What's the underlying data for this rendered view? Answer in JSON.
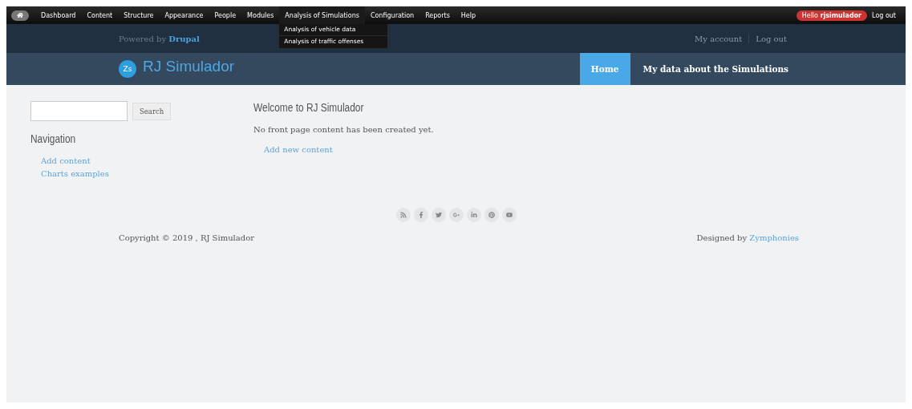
{
  "admin_toolbar": {
    "items": [
      {
        "label": "Dashboard",
        "expanded": false
      },
      {
        "label": "Content",
        "expanded": false
      },
      {
        "label": "Structure",
        "expanded": false
      },
      {
        "label": "Appearance",
        "expanded": false
      },
      {
        "label": "People",
        "expanded": false
      },
      {
        "label": "Modules",
        "expanded": false
      },
      {
        "label": "Analysis of Simulations",
        "expanded": true,
        "children": [
          "Analysis of vehicle data",
          "Analysis of traffic offenses"
        ]
      },
      {
        "label": "Configuration",
        "expanded": false
      },
      {
        "label": "Reports",
        "expanded": false
      },
      {
        "label": "Help",
        "expanded": false
      }
    ],
    "greeting": "Hello",
    "username": "rjsimulador",
    "logout": "Log out"
  },
  "header": {
    "powered_by": "Powered by",
    "powered_brand": "Drupal",
    "user_links": [
      "My account",
      "Log out"
    ]
  },
  "site": {
    "name": "RJ Simulador",
    "logo_text": "Zs"
  },
  "main_menu": [
    {
      "label": "Home",
      "selected": true
    },
    {
      "label": "My data about the Simulations",
      "selected": false
    }
  ],
  "sidebar": {
    "search_button": "Search",
    "nav_title": "Navigation",
    "nav_links": [
      "Add content",
      "Charts examples"
    ]
  },
  "content": {
    "title": "Welcome to RJ Simulador",
    "message": "No front page content has been created yet.",
    "link": "Add new content"
  },
  "footer": {
    "social": [
      {
        "kind": "rss"
      },
      {
        "kind": "facebook"
      },
      {
        "kind": "twitter"
      },
      {
        "kind": "googleplus"
      },
      {
        "kind": "linkedin"
      },
      {
        "kind": "pinterest"
      },
      {
        "kind": "youtube"
      }
    ],
    "copyright": "Copyright © 2019 , RJ Simulador",
    "designed_by": "Designed by",
    "designer": "Zymphonies"
  }
}
